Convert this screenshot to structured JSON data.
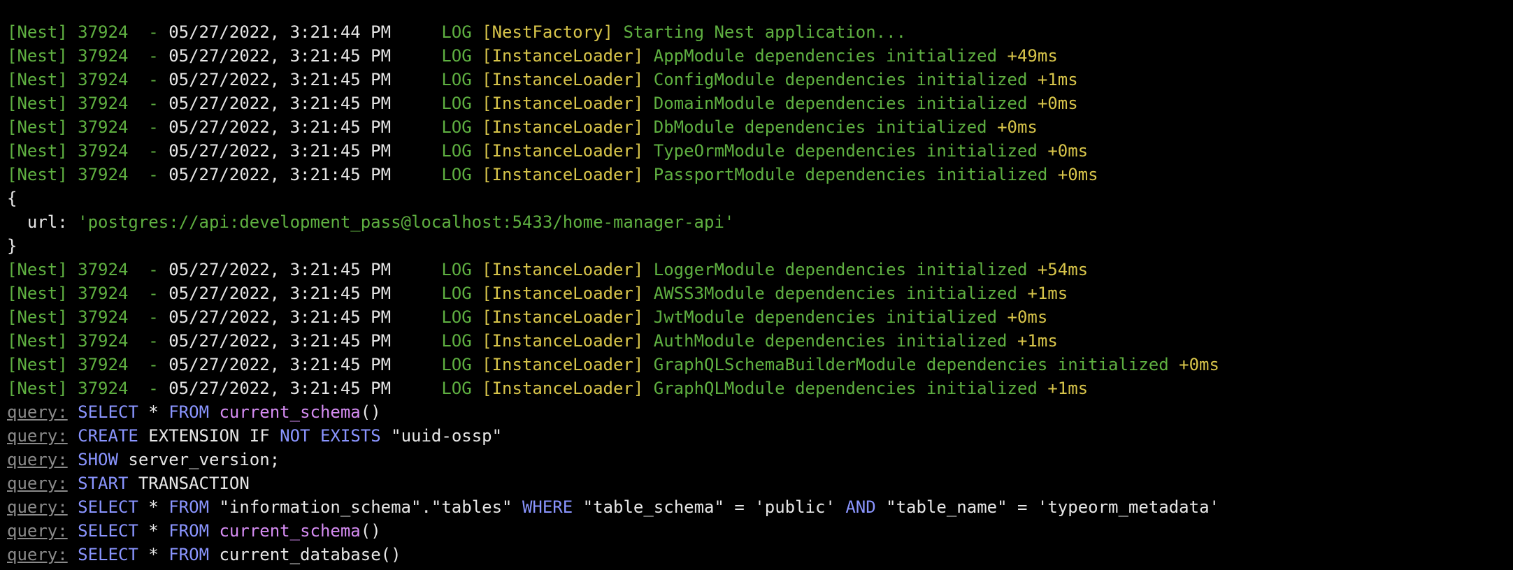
{
  "colors": {
    "background": "#000000",
    "green": "#5fb041",
    "yellow": "#d7c44a",
    "text": "#e6e6e6",
    "keyword": "#8a95ff",
    "function": "#d58cf2",
    "dim": "#8a8a8a"
  },
  "nest_logs": [
    {
      "prefix": "[Nest] 37924  - ",
      "timestamp": "05/27/2022, 3:21:44 PM",
      "level": "LOG",
      "context": "[NestFactory]",
      "message": "Starting Nest application...",
      "timing": ""
    },
    {
      "prefix": "[Nest] 37924  - ",
      "timestamp": "05/27/2022, 3:21:45 PM",
      "level": "LOG",
      "context": "[InstanceLoader]",
      "message": "AppModule dependencies initialized",
      "timing": "+49ms"
    },
    {
      "prefix": "[Nest] 37924  - ",
      "timestamp": "05/27/2022, 3:21:45 PM",
      "level": "LOG",
      "context": "[InstanceLoader]",
      "message": "ConfigModule dependencies initialized",
      "timing": "+1ms"
    },
    {
      "prefix": "[Nest] 37924  - ",
      "timestamp": "05/27/2022, 3:21:45 PM",
      "level": "LOG",
      "context": "[InstanceLoader]",
      "message": "DomainModule dependencies initialized",
      "timing": "+0ms"
    },
    {
      "prefix": "[Nest] 37924  - ",
      "timestamp": "05/27/2022, 3:21:45 PM",
      "level": "LOG",
      "context": "[InstanceLoader]",
      "message": "DbModule dependencies initialized",
      "timing": "+0ms"
    },
    {
      "prefix": "[Nest] 37924  - ",
      "timestamp": "05/27/2022, 3:21:45 PM",
      "level": "LOG",
      "context": "[InstanceLoader]",
      "message": "TypeOrmModule dependencies initialized",
      "timing": "+0ms"
    },
    {
      "prefix": "[Nest] 37924  - ",
      "timestamp": "05/27/2022, 3:21:45 PM",
      "level": "LOG",
      "context": "[InstanceLoader]",
      "message": "PassportModule dependencies initialized",
      "timing": "+0ms"
    }
  ],
  "config_object": {
    "open_brace": "{",
    "key": "  url: ",
    "value": "'postgres://api:development_pass@localhost:5433/home-manager-api'",
    "close_brace": "}"
  },
  "nest_logs_2": [
    {
      "prefix": "[Nest] 37924  - ",
      "timestamp": "05/27/2022, 3:21:45 PM",
      "level": "LOG",
      "context": "[InstanceLoader]",
      "message": "LoggerModule dependencies initialized",
      "timing": "+54ms"
    },
    {
      "prefix": "[Nest] 37924  - ",
      "timestamp": "05/27/2022, 3:21:45 PM",
      "level": "LOG",
      "context": "[InstanceLoader]",
      "message": "AWSS3Module dependencies initialized",
      "timing": "+1ms"
    },
    {
      "prefix": "[Nest] 37924  - ",
      "timestamp": "05/27/2022, 3:21:45 PM",
      "level": "LOG",
      "context": "[InstanceLoader]",
      "message": "JwtModule dependencies initialized",
      "timing": "+0ms"
    },
    {
      "prefix": "[Nest] 37924  - ",
      "timestamp": "05/27/2022, 3:21:45 PM",
      "level": "LOG",
      "context": "[InstanceLoader]",
      "message": "AuthModule dependencies initialized",
      "timing": "+1ms"
    },
    {
      "prefix": "[Nest] 37924  - ",
      "timestamp": "05/27/2022, 3:21:45 PM",
      "level": "LOG",
      "context": "[InstanceLoader]",
      "message": "GraphQLSchemaBuilderModule dependencies initialized",
      "timing": "+0ms"
    },
    {
      "prefix": "[Nest] 37924  - ",
      "timestamp": "05/27/2022, 3:21:45 PM",
      "level": "LOG",
      "context": "[InstanceLoader]",
      "message": "GraphQLModule dependencies initialized",
      "timing": "+1ms"
    }
  ],
  "query_label": "query:",
  "queries": [
    [
      {
        "t": "SELECT",
        "c": "blue"
      },
      {
        "t": " * ",
        "c": "plain"
      },
      {
        "t": "FROM",
        "c": "blue"
      },
      {
        "t": " ",
        "c": "plain"
      },
      {
        "t": "current_schema",
        "c": "magenta"
      },
      {
        "t": "()",
        "c": "plain"
      }
    ],
    [
      {
        "t": "CREATE",
        "c": "blue"
      },
      {
        "t": " EXTENSION IF ",
        "c": "plain"
      },
      {
        "t": "NOT",
        "c": "blue"
      },
      {
        "t": " ",
        "c": "plain"
      },
      {
        "t": "EXISTS",
        "c": "blue"
      },
      {
        "t": " \"uuid-ossp\"",
        "c": "plain"
      }
    ],
    [
      {
        "t": "SHOW",
        "c": "blue"
      },
      {
        "t": " server_version;",
        "c": "plain"
      }
    ],
    [
      {
        "t": "START",
        "c": "blue"
      },
      {
        "t": " TRANSACTION",
        "c": "plain"
      }
    ],
    [
      {
        "t": "SELECT",
        "c": "blue"
      },
      {
        "t": " * ",
        "c": "plain"
      },
      {
        "t": "FROM",
        "c": "blue"
      },
      {
        "t": " \"information_schema\".\"tables\" ",
        "c": "plain"
      },
      {
        "t": "WHERE",
        "c": "blue"
      },
      {
        "t": " \"table_schema\" = 'public' ",
        "c": "plain"
      },
      {
        "t": "AND",
        "c": "blue"
      },
      {
        "t": " \"table_name\" = 'typeorm_metadata'",
        "c": "plain"
      }
    ],
    [
      {
        "t": "SELECT",
        "c": "blue"
      },
      {
        "t": " * ",
        "c": "plain"
      },
      {
        "t": "FROM",
        "c": "blue"
      },
      {
        "t": " ",
        "c": "plain"
      },
      {
        "t": "current_schema",
        "c": "magenta"
      },
      {
        "t": "()",
        "c": "plain"
      }
    ],
    [
      {
        "t": "SELECT",
        "c": "blue"
      },
      {
        "t": " * ",
        "c": "plain"
      },
      {
        "t": "FROM",
        "c": "blue"
      },
      {
        "t": " current_database()",
        "c": "plain"
      }
    ]
  ]
}
